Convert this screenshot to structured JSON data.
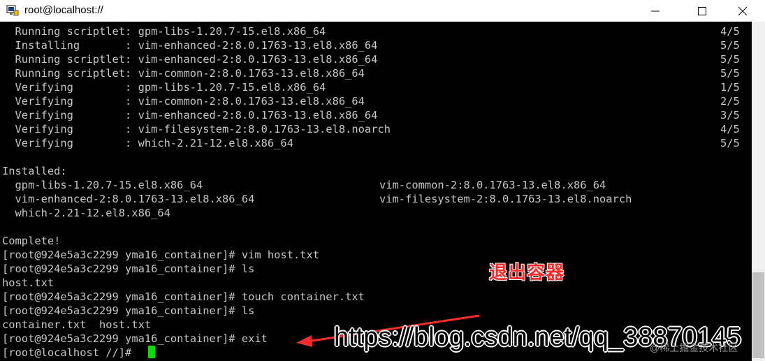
{
  "window": {
    "title": "root@localhost://"
  },
  "terminal": {
    "transaction_lines": [
      {
        "text": "  Running scriptlet: gpm-libs-1.20.7-15.el8.x86_64",
        "count": "4/5"
      },
      {
        "text": "  Installing       : vim-enhanced-2:8.0.1763-13.el8.x86_64",
        "count": "5/5"
      },
      {
        "text": "  Running scriptlet: vim-enhanced-2:8.0.1763-13.el8.x86_64",
        "count": "5/5"
      },
      {
        "text": "  Running scriptlet: vim-common-2:8.0.1763-13.el8.x86_64",
        "count": "5/5"
      },
      {
        "text": "  Verifying        : gpm-libs-1.20.7-15.el8.x86_64",
        "count": "1/5"
      },
      {
        "text": "  Verifying        : vim-common-2:8.0.1763-13.el8.x86_64",
        "count": "2/5"
      },
      {
        "text": "  Verifying        : vim-enhanced-2:8.0.1763-13.el8.x86_64",
        "count": "3/5"
      },
      {
        "text": "  Verifying        : vim-filesystem-2:8.0.1763-13.el8.noarch",
        "count": "4/5"
      },
      {
        "text": "  Verifying        : which-2.21-12.el8.x86_64",
        "count": "5/5"
      }
    ],
    "installed_header": "Installed:",
    "installed_rows": [
      {
        "left": "  gpm-libs-1.20.7-15.el8.x86_64",
        "right": "vim-common-2:8.0.1763-13.el8.x86_64"
      },
      {
        "left": "  vim-enhanced-2:8.0.1763-13.el8.x86_64",
        "right": "vim-filesystem-2:8.0.1763-13.el8.noarch"
      },
      {
        "left": "  which-2.21-12.el8.x86_64",
        "right": ""
      }
    ],
    "complete": "Complete!",
    "session": [
      "[root@924e5a3c2299 yma16_container]# vim host.txt",
      "[root@924e5a3c2299 yma16_container]# ls",
      "host.txt",
      "[root@924e5a3c2299 yma16_container]# touch container.txt",
      "[root@924e5a3c2299 yma16_container]# ls",
      "container.txt  host.txt",
      "[root@924e5a3c2299 yma16_container]# exit",
      "[root@localhost //]# "
    ]
  },
  "annotation": {
    "label": "退出容器",
    "url": "https://blog.csdn.net/qq_38870145",
    "watermark": "@稀土掘金技术社区"
  },
  "icons": {
    "app": "terminal-app-icon",
    "min": "minimize-icon",
    "max": "maximize-icon",
    "close": "close-icon"
  },
  "colors": {
    "annotation": "#ff2a2a",
    "cursor": "#00e000",
    "terminal_bg": "#000000",
    "terminal_fg": "#c6c6c6"
  }
}
